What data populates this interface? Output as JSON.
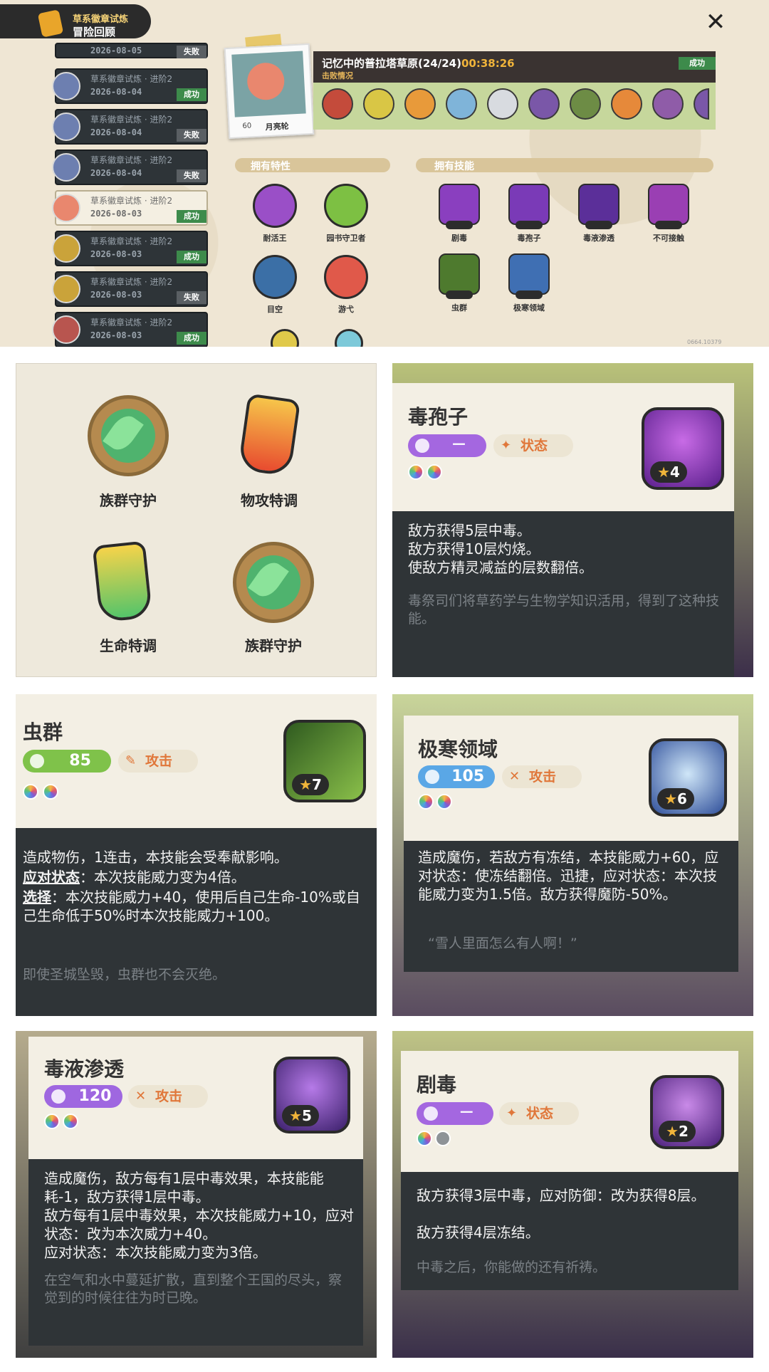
{
  "header": {
    "line1": "草系徽章试炼",
    "line2": "冒险回顾"
  },
  "close_icon": "close-icon",
  "records": [
    {
      "title": "",
      "date": "2026-08-05",
      "status": "失败",
      "ok": false
    },
    {
      "title": "草系徽章试炼 · 进阶2",
      "date": "2026-08-04",
      "status": "成功",
      "ok": true
    },
    {
      "title": "草系徽章试炼 · 进阶2",
      "date": "2026-08-04",
      "status": "失败",
      "ok": false
    },
    {
      "title": "草系徽章试炼 · 进阶2",
      "date": "2026-08-04",
      "status": "失败",
      "ok": false
    },
    {
      "title": "草系徽章试炼 · 进阶2",
      "date": "2026-08-03",
      "status": "成功",
      "ok": true
    },
    {
      "title": "草系徽章试炼 · 进阶2",
      "date": "2026-08-03",
      "status": "成功",
      "ok": true
    },
    {
      "title": "草系徽章试炼 · 进阶2",
      "date": "2026-08-03",
      "status": "失败",
      "ok": false
    },
    {
      "title": "草系徽章试炼 · 进阶2",
      "date": "2026-08-03",
      "status": "成功",
      "ok": true
    }
  ],
  "pet": {
    "level": "60",
    "name": "月亮轮"
  },
  "battle": {
    "title": "记忆中的普拉塔草原(24/24)",
    "time": "00:38:26",
    "status": "成功",
    "defeat_label": "击败情况"
  },
  "traits_title": "拥有特性",
  "skills_title": "拥有技能",
  "traits": [
    "耐活王",
    "园书守卫者",
    "目空",
    "游弋"
  ],
  "skills": [
    "剧毒",
    "毒孢子",
    "毒液渗透",
    "不可接触",
    "虫群",
    "极寒领域"
  ],
  "version": "0664.10379",
  "items": [
    "族群守护",
    "物攻特调",
    "生命特调",
    "族群守护"
  ],
  "cards": {
    "spore": {
      "name": "毒孢子",
      "power": "－",
      "category": "状态",
      "stars": "4",
      "desc": [
        "敌方获得5层中毒。",
        "敌方获得10层灼烧。",
        "使敌方精灵减益的层数翻倍。"
      ],
      "flavor": "毒祭司们将草药学与生物学知识活用，得到了这种技能。"
    },
    "swarm": {
      "name": "虫群",
      "power": "85",
      "category": "攻击",
      "stars": "7",
      "desc1": "造成物伤，1连击，本技能会受奉献影响。",
      "desc2a": "应对状态",
      "desc2b": "：本次技能威力变为4倍。",
      "desc3a": "选择",
      "desc3b": "：本次技能威力+40，使用后自己生命-10%或自己生命低于50%时本次技能威力+100。",
      "flavor": "即使圣城坠毁，虫群也不会灭绝。"
    },
    "frost": {
      "name": "极寒领域",
      "power": "105",
      "category": "攻击",
      "stars": "6",
      "desc": "造成魔伤，若敌方有冻结，本技能威力+60，应对状态：使冻结翻倍。迅捷，应对状态：本次技能威力变为1.5倍。敌方获得魔防-50%。",
      "flavor": "“雪人里面怎么有人啊！”"
    },
    "venom": {
      "name": "毒液渗透",
      "power": "120",
      "category": "攻击",
      "stars": "5",
      "desc": [
        "造成魔伤，敌方每有1层中毒效果，本技能能耗-1，敌方获得1层中毒。",
        "敌方每有1层中毒效果，本次技能威力+10，应对状态：改为本次威力+40。",
        "应对状态：本次技能威力变为3倍。"
      ],
      "flavor": "在空气和水中蔓延扩散，直到整个王国的尽头，察觉到的时候往往为时已晚。"
    },
    "toxic": {
      "name": "剧毒",
      "power": "－",
      "category": "状态",
      "stars": "2",
      "desc": [
        "敌方获得3层中毒，应对防御：改为获得8层。",
        "敌方获得4层冻结。"
      ],
      "flavor": "中毒之后，你能做的还有祈祷。"
    }
  }
}
